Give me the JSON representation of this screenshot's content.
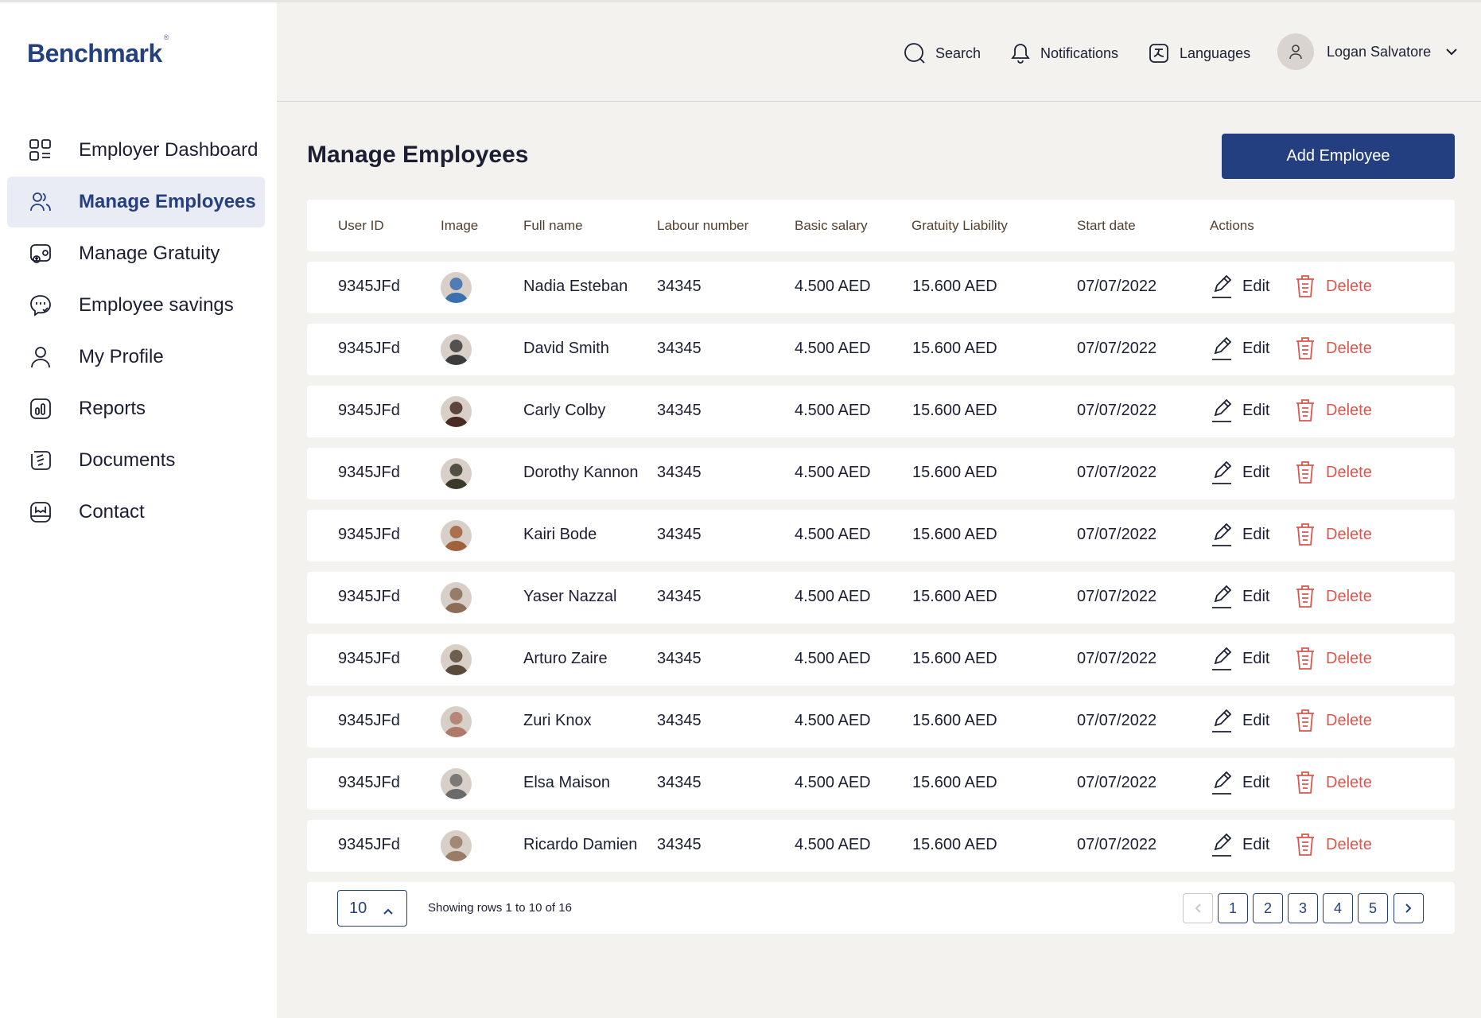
{
  "app": {
    "logo": "Benchmark",
    "logo_mark": "®"
  },
  "sidebar": {
    "items": [
      {
        "label": "Employer Dashboard",
        "icon": "dashboard-grid-icon"
      },
      {
        "label": "Manage Employees",
        "icon": "users-icon",
        "active": true
      },
      {
        "label": "Manage Gratuity",
        "icon": "gratuity-icon"
      },
      {
        "label": "Employee savings",
        "icon": "savings-icon"
      },
      {
        "label": "My Profile",
        "icon": "user-icon"
      },
      {
        "label": "Reports",
        "icon": "reports-icon"
      },
      {
        "label": "Documents",
        "icon": "documents-icon"
      },
      {
        "label": "Contact",
        "icon": "contact-icon"
      }
    ]
  },
  "header": {
    "search": "Search",
    "notifications": "Notifications",
    "languages": "Languages",
    "user_name": "Logan Salvatore"
  },
  "main": {
    "title": "Manage Employees",
    "add_button": "Add Employee",
    "columns": [
      "User ID",
      "Image",
      "Full name",
      "Labour number",
      "Basic salary",
      "Gratuity Liability",
      "Start date",
      "Actions"
    ],
    "edit_label": "Edit",
    "delete_label": "Delete",
    "rows": [
      {
        "user_id": "9345JFd",
        "name": "Nadia Esteban",
        "labour": "34345",
        "salary": "4.500 AED",
        "gratuity": "15.600 AED",
        "start": "07/07/2022",
        "avatar_color": "#3a6fb0"
      },
      {
        "user_id": "9345JFd",
        "name": "David Smith",
        "labour": "34345",
        "salary": "4.500 AED",
        "gratuity": "15.600 AED",
        "start": "07/07/2022",
        "avatar_color": "#3c3c3c"
      },
      {
        "user_id": "9345JFd",
        "name": "Carly Colby",
        "labour": "34345",
        "salary": "4.500 AED",
        "gratuity": "15.600 AED",
        "start": "07/07/2022",
        "avatar_color": "#4a2b22"
      },
      {
        "user_id": "9345JFd",
        "name": "Dorothy Kannon",
        "labour": "34345",
        "salary": "4.500 AED",
        "gratuity": "15.600 AED",
        "start": "07/07/2022",
        "avatar_color": "#3b3a2a"
      },
      {
        "user_id": "9345JFd",
        "name": "Kairi Bode",
        "labour": "34345",
        "salary": "4.500 AED",
        "gratuity": "15.600 AED",
        "start": "07/07/2022",
        "avatar_color": "#a0623d"
      },
      {
        "user_id": "9345JFd",
        "name": "Yaser Nazzal",
        "labour": "34345",
        "salary": "4.500 AED",
        "gratuity": "15.600 AED",
        "start": "07/07/2022",
        "avatar_color": "#8c6d58"
      },
      {
        "user_id": "9345JFd",
        "name": "Arturo Zaire",
        "labour": "34345",
        "salary": "4.500 AED",
        "gratuity": "15.600 AED",
        "start": "07/07/2022",
        "avatar_color": "#5a4a3a"
      },
      {
        "user_id": "9345JFd",
        "name": "Zuri Knox",
        "labour": "34345",
        "salary": "4.500 AED",
        "gratuity": "15.600 AED",
        "start": "07/07/2022",
        "avatar_color": "#b07a6a"
      },
      {
        "user_id": "9345JFd",
        "name": "Elsa Maison",
        "labour": "34345",
        "salary": "4.500 AED",
        "gratuity": "15.600 AED",
        "start": "07/07/2022",
        "avatar_color": "#6a6a6a"
      },
      {
        "user_id": "9345JFd",
        "name": "Ricardo Damien",
        "labour": "34345",
        "salary": "4.500 AED",
        "gratuity": "15.600 AED",
        "start": "07/07/2022",
        "avatar_color": "#9a7b66"
      }
    ]
  },
  "pagination": {
    "per_page": "10",
    "showing": "Showing rows 1 to 10 of 16",
    "pages": [
      "1",
      "2",
      "3",
      "4",
      "5"
    ]
  },
  "colors": {
    "primary": "#243f80",
    "danger": "#d9574f",
    "background": "#f3f2ef"
  }
}
